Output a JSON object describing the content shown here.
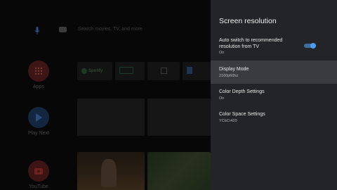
{
  "home": {
    "search_placeholder": "Search movies, TV, and more",
    "side_apps": [
      {
        "label": "Apps",
        "icon": "apps-grid-icon"
      },
      {
        "label": "Play Next",
        "icon": "play-icon"
      },
      {
        "label": "YouTube",
        "icon": "youtube-icon"
      }
    ],
    "app_tiles": [
      "Spotify"
    ]
  },
  "panel": {
    "title": "Screen resolution",
    "items": [
      {
        "title": "Auto switch to recommended resolution from TV",
        "value": "On",
        "toggle": true
      },
      {
        "title": "Display Mode",
        "value": "2160p60hz"
      },
      {
        "title": "Color Depth Settings",
        "value": "On"
      },
      {
        "title": "Color Space Settings",
        "value": "YCbCr420"
      }
    ]
  },
  "colors": {
    "panel_bg": "#232427",
    "selected_row": "#3a3b3f",
    "toggle_accent": "#4a9df0"
  }
}
